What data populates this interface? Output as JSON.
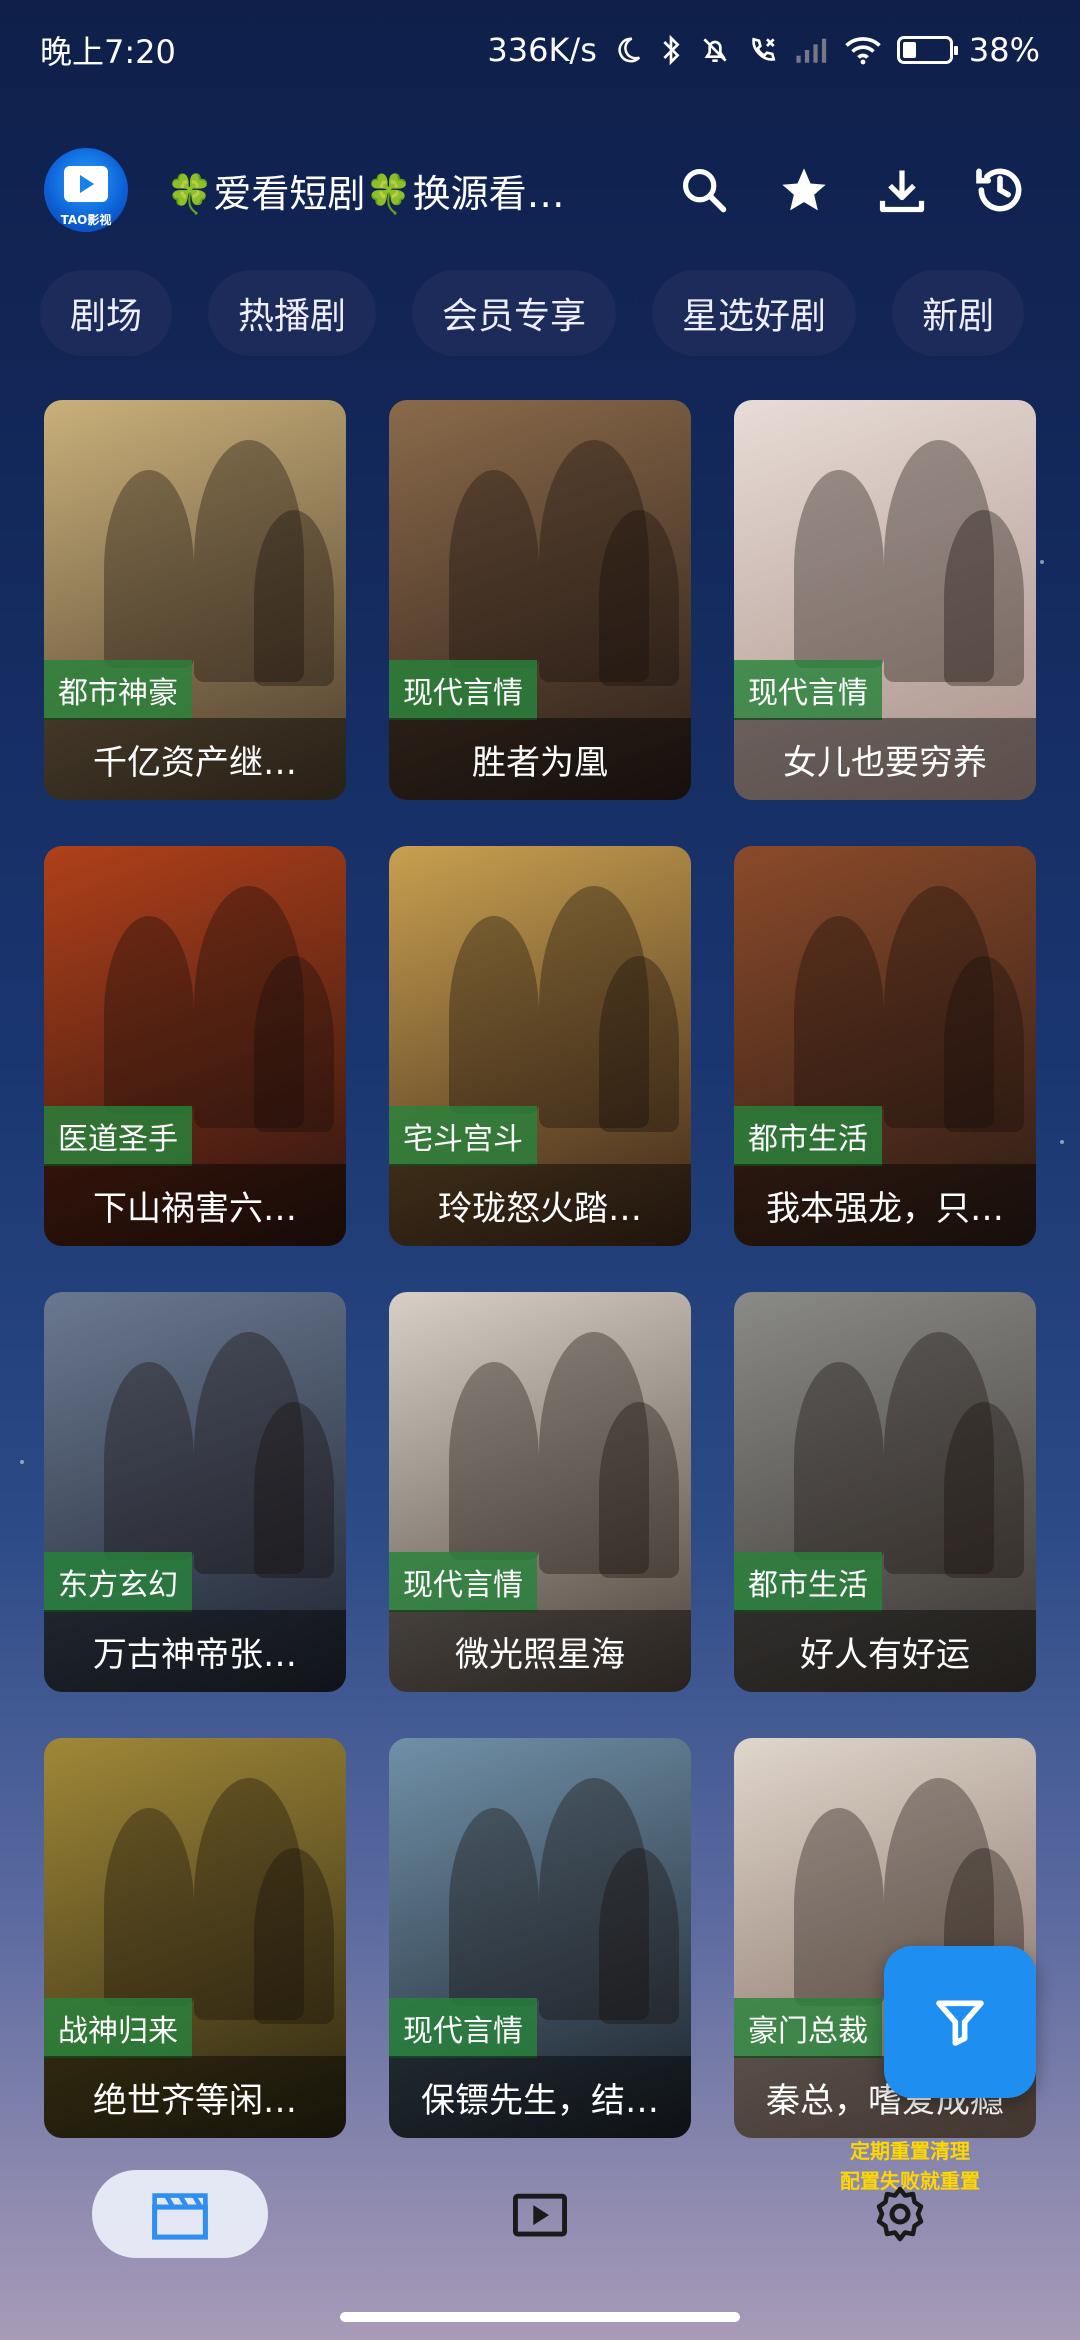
{
  "status_bar": {
    "time": "晚上7:20",
    "net_speed": "336K/s",
    "battery_percent": "38%",
    "battery_level": 0.38,
    "icons": [
      "moon-icon",
      "bluetooth-icon",
      "mute-icon",
      "missed-call-icon",
      "signal-icon",
      "wifi-icon",
      "battery-icon"
    ]
  },
  "app_bar": {
    "logo_text": "TAO影视",
    "title": "🍀爱看短剧🍀换源看更...",
    "actions": [
      "search-icon",
      "star-icon",
      "download-icon",
      "history-icon"
    ]
  },
  "tabs": [
    "剧场",
    "热播剧",
    "会员专享",
    "星选好剧",
    "新剧"
  ],
  "cards": [
    {
      "tag": "都市神豪",
      "title": "千亿资产继…",
      "colors": [
        "#c9b07a",
        "#4a3a2a"
      ]
    },
    {
      "tag": "现代言情",
      "title": "胜者为凰",
      "colors": [
        "#8a6a4a",
        "#2a1d18"
      ]
    },
    {
      "tag": "现代言情",
      "title": "女儿也要穷养",
      "colors": [
        "#e8dcd6",
        "#a89088"
      ]
    },
    {
      "tag": "医道圣手",
      "title": "下山祸害六…",
      "colors": [
        "#b0401a",
        "#2a1410"
      ]
    },
    {
      "tag": "宅斗宫斗",
      "title": "玲珑怒火踏…",
      "colors": [
        "#c8a050",
        "#3a2418"
      ]
    },
    {
      "tag": "都市生活",
      "title": "我本强龙，只…",
      "colors": [
        "#8a4a2a",
        "#2a1a14"
      ]
    },
    {
      "tag": "东方玄幻",
      "title": "万古神帝张…",
      "colors": [
        "#6a7890",
        "#1e2430"
      ]
    },
    {
      "tag": "现代言情",
      "title": "微光照星海",
      "colors": [
        "#d8d0c6",
        "#4a4038"
      ]
    },
    {
      "tag": "都市生活",
      "title": "好人有好运",
      "colors": [
        "#8a8a86",
        "#3a3430"
      ]
    },
    {
      "tag": "战神归来",
      "title": "绝世齐等闲…",
      "colors": [
        "#a08838",
        "#2a2410"
      ]
    },
    {
      "tag": "现代言情",
      "title": "保镖先生，结…",
      "colors": [
        "#7090a8",
        "#1a2028"
      ]
    },
    {
      "tag": "豪门总裁",
      "title": "秦总，嗜爱成瘾",
      "colors": [
        "#e0d6cc",
        "#7a6458"
      ]
    }
  ],
  "fab": {
    "icon": "filter-icon"
  },
  "notice": {
    "line1": "定期重置清理",
    "line2": "配置失败就重置"
  },
  "bottom_nav": [
    {
      "icon": "clapperboard-icon",
      "active": true
    },
    {
      "icon": "play-box-icon",
      "active": false
    },
    {
      "icon": "gear-icon",
      "active": false
    }
  ]
}
